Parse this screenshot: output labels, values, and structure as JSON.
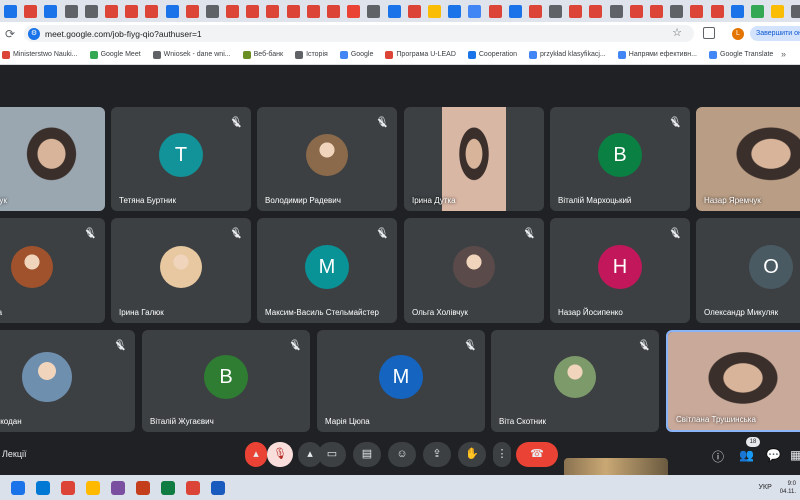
{
  "browser": {
    "tab_icon_colors": [
      "#1a73e8",
      "#db4437",
      "#1a73e8",
      "#5f6368",
      "#5f6368",
      "#db4437",
      "#db4437",
      "#db4437",
      "#1a73e8",
      "#db4437",
      "#5f6368",
      "#db4437",
      "#db4437",
      "#db4437",
      "#db4437",
      "#db4437",
      "#db4437",
      "#ea4335",
      "#5f6368",
      "#1a73e8",
      "#db4437",
      "#fbbc04",
      "#1a73e8",
      "#4285f4",
      "#db4437",
      "#1a73e8",
      "#db4437",
      "#5f6368",
      "#db4437",
      "#db4437",
      "#5f6368",
      "#db4437",
      "#db4437",
      "#5f6368",
      "#db4437",
      "#db4437",
      "#1a73e8",
      "#34a853",
      "#fbbc04",
      "#5f6368"
    ],
    "new_tab_label": "+",
    "url": "meet.google.com/job-fiyg-qio?authuser=1",
    "profile_initial": "L",
    "finish_update_label": "Завершити он",
    "bookmarks": [
      {
        "label": "Ministerstwo Nauki...",
        "icon_color": "#db4437"
      },
      {
        "label": "Google Meet",
        "icon_color": "#34a853"
      },
      {
        "label": "Wniosek - dane wni...",
        "icon_color": "#5f6368"
      },
      {
        "label": "Веб-банк",
        "icon_color": "#6b8e23"
      },
      {
        "label": "Історія",
        "icon_color": "#5f6368"
      },
      {
        "label": "Google",
        "icon_color": "#4285f4"
      },
      {
        "label": "Програма U-LEAD",
        "icon_color": "#db4437"
      },
      {
        "label": "Cooperation",
        "icon_color": "#1a73e8"
      },
      {
        "label": "przykład klasyfikacj...",
        "icon_color": "#4285f4"
      },
      {
        "label": "Напрями ефективн...",
        "icon_color": "#4285f4"
      },
      {
        "label": "Google Translate",
        "icon_color": "#4285f4"
      }
    ],
    "bookmarks_more": "»"
  },
  "meet": {
    "meeting_name": "Лекції",
    "participants": [
      {
        "name": "Стефанчук",
        "kind": "video",
        "bg": "#9aa7b0"
      },
      {
        "name": "Тетяна Буртник",
        "kind": "initial",
        "initial": "Т",
        "color": "#12939a"
      },
      {
        "name": "Володимир Радевич",
        "kind": "photo",
        "bg": "#8a6a4a"
      },
      {
        "name": "Ірина Дутка",
        "kind": "video",
        "bg": "#d9b7a5"
      },
      {
        "name": "Віталій Мархоцький",
        "kind": "initial",
        "initial": "В",
        "color": "#0b8043"
      },
      {
        "name": "Назар Яремчук",
        "kind": "video",
        "bg": "#b99d85"
      },
      {
        "name": "a Shunina",
        "kind": "photo",
        "bg": "#a0522d"
      },
      {
        "name": "Ірина Галюк",
        "kind": "photo",
        "bg": "#e8c8a0"
      },
      {
        "name": "Максим-Василь Стельмайстер",
        "kind": "initial",
        "initial": "М",
        "color": "#0a9396"
      },
      {
        "name": "Ольга Холівчук",
        "kind": "photo",
        "bg": "#5a4a4a"
      },
      {
        "name": "Назар Йосипенко",
        "kind": "initial",
        "initial": "Н",
        "color": "#c2185b"
      },
      {
        "name": "Олександр Микуляк",
        "kind": "initial",
        "initial": "О",
        "color": "#4a5a63"
      },
      {
        "name": "имир Кочкодан",
        "kind": "photo",
        "bg": "#6f8fae"
      },
      {
        "name": "Віталій Жугаєвич",
        "kind": "initial",
        "initial": "В",
        "color": "#2e7d32"
      },
      {
        "name": "Марія Цюпа",
        "kind": "initial",
        "initial": "М",
        "color": "#1565c0"
      },
      {
        "name": "Віта Скотник",
        "kind": "photo",
        "bg": "#7d9a6a"
      },
      {
        "name": "Світлана Трушинська",
        "kind": "video",
        "bg": "#c9a99a"
      }
    ],
    "people_count": "18"
  },
  "taskbar": {
    "icon_colors": [
      "#1a73e8",
      "#0078d4",
      "#db4437",
      "#ffb900",
      "#7b4fa0",
      "#c43e1c",
      "#107c41",
      "#db4437",
      "#185abd"
    ],
    "language": "УКР",
    "time": "9:0",
    "date": "04.11."
  }
}
